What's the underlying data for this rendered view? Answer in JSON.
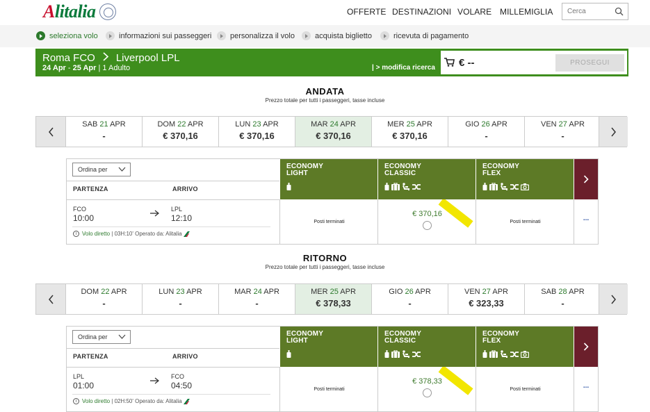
{
  "brand": {
    "logo_text": "Alitalia",
    "logo_text_red": "A"
  },
  "nav": [
    "OFFERTE",
    "DESTINAZIONI",
    "VOLARE",
    "MILLEMIGLIA"
  ],
  "search": {
    "placeholder": "Cerca"
  },
  "steps": [
    {
      "label": "seleziona volo",
      "active": true
    },
    {
      "label": "informazioni sui passeggeri",
      "active": false
    },
    {
      "label": "personalizza il volo",
      "active": false
    },
    {
      "label": "acquista biglietto",
      "active": false
    },
    {
      "label": "ricevuta di pagamento",
      "active": false
    }
  ],
  "route": {
    "origin": "Roma FCO",
    "destination": "Liverpool LPL",
    "depart_date": "24 Apr",
    "return_date": "25 Apr",
    "pax": "1 Adulto",
    "modify_label": "| > modifica ricerca",
    "cart_price": "€ --",
    "proceed_label": "PROSEGUI"
  },
  "outbound": {
    "title": "ANDATA",
    "subtitle": "Prezzo totale per tutti i passeggeri, tasse incluse",
    "dates": [
      {
        "day": "SAB",
        "num": "21",
        "month": "APR",
        "price": "-",
        "selected": false
      },
      {
        "day": "DOM",
        "num": "22",
        "month": "APR",
        "price": "€ 370,16",
        "selected": false
      },
      {
        "day": "LUN",
        "num": "23",
        "month": "APR",
        "price": "€ 370,16",
        "selected": false
      },
      {
        "day": "MAR",
        "num": "24",
        "month": "APR",
        "price": "€ 370,16",
        "selected": true
      },
      {
        "day": "MER",
        "num": "25",
        "month": "APR",
        "price": "€ 370,16",
        "selected": false
      },
      {
        "day": "GIO",
        "num": "26",
        "month": "APR",
        "price": "-",
        "selected": false
      },
      {
        "day": "VEN",
        "num": "27",
        "month": "APR",
        "price": "-",
        "selected": false
      }
    ],
    "order_label": "Ordina per",
    "col_departure": "PARTENZA",
    "col_arrival": "ARRIVO",
    "flight": {
      "from": "FCO",
      "dep_time": "10:00",
      "to": "LPL",
      "arr_time": "12:10",
      "info_direct": "Volo diretto",
      "info_rest": "| 03H:10' Operato da: Alitalia"
    },
    "fares": [
      {
        "name1": "ECONOMY",
        "name2": "LIGHT",
        "status": "Posti terminati",
        "price": ""
      },
      {
        "name1": "ECONOMY",
        "name2": "CLASSIC",
        "status": "",
        "price": "€ 370,16"
      },
      {
        "name1": "ECONOMY",
        "name2": "FLEX",
        "status": "Posti terminati",
        "price": ""
      }
    ],
    "more": "..."
  },
  "return": {
    "title": "RITORNO",
    "subtitle": "Prezzo totale per tutti i passeggeri, tasse incluse",
    "dates": [
      {
        "day": "DOM",
        "num": "22",
        "month": "APR",
        "price": "-",
        "selected": false
      },
      {
        "day": "LUN",
        "num": "23",
        "month": "APR",
        "price": "-",
        "selected": false
      },
      {
        "day": "MAR",
        "num": "24",
        "month": "APR",
        "price": "-",
        "selected": false
      },
      {
        "day": "MER",
        "num": "25",
        "month": "APR",
        "price": "€ 378,33",
        "selected": true
      },
      {
        "day": "GIO",
        "num": "26",
        "month": "APR",
        "price": "-",
        "selected": false
      },
      {
        "day": "VEN",
        "num": "27",
        "month": "APR",
        "price": "€ 323,33",
        "selected": false
      },
      {
        "day": "SAB",
        "num": "28",
        "month": "APR",
        "price": "-",
        "selected": false
      }
    ],
    "order_label": "Ordina per",
    "col_departure": "PARTENZA",
    "col_arrival": "ARRIVO",
    "flight": {
      "from": "LPL",
      "dep_time": "01:00",
      "to": "FCO",
      "arr_time": "04:50",
      "info_direct": "Volo diretto",
      "info_rest": "| 02H:50' Operato da: Alitalia"
    },
    "fares": [
      {
        "name1": "ECONOMY",
        "name2": "LIGHT",
        "status": "Posti terminati",
        "price": ""
      },
      {
        "name1": "ECONOMY",
        "name2": "CLASSIC",
        "status": "",
        "price": "€ 378,33"
      },
      {
        "name1": "ECONOMY",
        "name2": "FLEX",
        "status": "Posti terminati",
        "price": ""
      }
    ],
    "more": "..."
  },
  "colors": {
    "green": "#3e8e1d",
    "fare_green": "#5d7a26",
    "burgundy": "#6b1f2b",
    "ribbon": "#f2e600"
  }
}
